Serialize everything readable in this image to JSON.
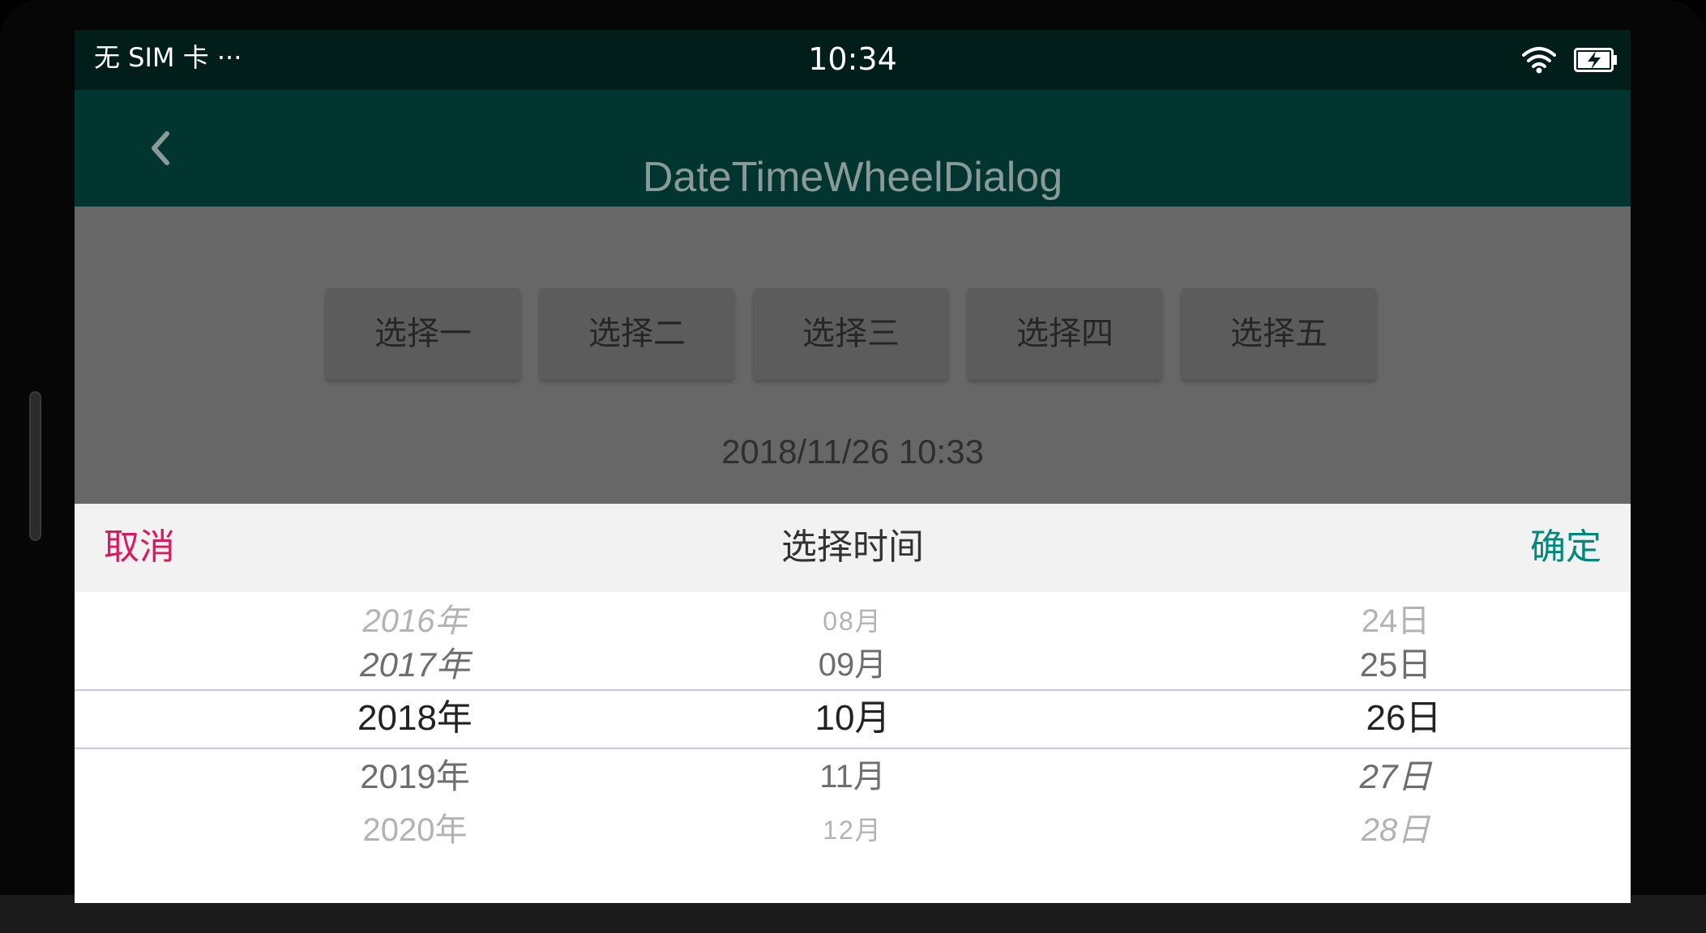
{
  "status_bar": {
    "carrier": "无 SIM 卡 ···",
    "time": "10:34",
    "icons": [
      "wifi-icon",
      "battery-charging-icon"
    ]
  },
  "toolbar": {
    "back_icon": "chevron-left-icon",
    "title": "DateTimeWheelDialog"
  },
  "buttons": [
    "选择一",
    "选择二",
    "选择三",
    "选择四",
    "选择五"
  ],
  "result": "2018/11/26 10:33",
  "dialog": {
    "cancel": "取消",
    "title": "选择时间",
    "confirm": "确定",
    "year_wheel": [
      "2016年",
      "2017年",
      "2018年",
      "2019年",
      "2020年"
    ],
    "month_wheel": [
      "08月",
      "09月",
      "10月",
      "11月",
      "12月"
    ],
    "day_wheel": [
      "24日",
      "25日",
      "26日",
      "27日",
      "28日"
    ],
    "selected": {
      "year": "2018年",
      "month": "10月",
      "day": "26日"
    }
  },
  "colors": {
    "status_bar": "#021e1a",
    "toolbar": "#02352f",
    "cancel": "#d81b60",
    "confirm": "#00897b",
    "selection_line": "#c5c5ee"
  }
}
